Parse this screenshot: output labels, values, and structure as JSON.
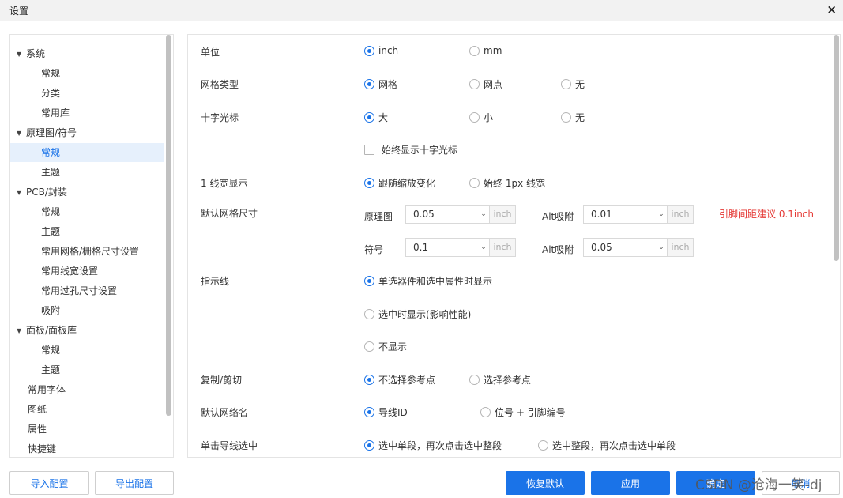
{
  "window": {
    "title": "设置",
    "close": "×"
  },
  "tree": {
    "items": [
      {
        "label": "系统",
        "caret": "▼"
      },
      {
        "label": "常规"
      },
      {
        "label": "分类"
      },
      {
        "label": "常用库"
      },
      {
        "label": "原理图/符号",
        "caret": "▼"
      },
      {
        "label": "常规"
      },
      {
        "label": "主题"
      },
      {
        "label": "PCB/封装",
        "caret": "▼"
      },
      {
        "label": "常规"
      },
      {
        "label": "主题"
      },
      {
        "label": "常用网格/栅格尺寸设置"
      },
      {
        "label": "常用线宽设置"
      },
      {
        "label": "常用过孔尺寸设置"
      },
      {
        "label": "吸附"
      },
      {
        "label": "面板/面板库",
        "caret": "▼"
      },
      {
        "label": "常规"
      },
      {
        "label": "主题"
      },
      {
        "label": "常用字体"
      },
      {
        "label": "图纸"
      },
      {
        "label": "属性"
      },
      {
        "label": "快捷键"
      }
    ],
    "selected_index": 5
  },
  "settings": {
    "unit": {
      "label": "单位",
      "options": [
        "inch",
        "mm"
      ]
    },
    "grid_type": {
      "label": "网格类型",
      "options": [
        "网格",
        "网点",
        "无"
      ]
    },
    "crosshair": {
      "label": "十字光标",
      "options": [
        "大",
        "小",
        "无"
      ],
      "checkbox": "始终显示十字光标"
    },
    "line_width": {
      "label": "1 线宽显示",
      "options": [
        "跟随缩放变化",
        "始终 1px 线宽"
      ]
    },
    "default_grid": {
      "label": "默认网格尺寸",
      "schematic_label": "原理图",
      "schematic_value": "0.05",
      "schematic_unit": "inch",
      "alt_label": "Alt吸附",
      "alt_value": "0.01",
      "alt_unit": "inch",
      "symbol_label": "符号",
      "symbol_value": "0.1",
      "symbol_unit": "inch",
      "symbol_alt_label": "Alt吸附",
      "symbol_alt_value": "0.05",
      "symbol_alt_unit": "inch",
      "hint": "引脚间距建议 0.1inch"
    },
    "indicator": {
      "label": "指示线",
      "options": [
        "单选器件和选中属性时显示",
        "选中时显示(影响性能)",
        "不显示"
      ]
    },
    "copy_cut": {
      "label": "复制/剪切",
      "options": [
        "不选择参考点",
        "选择参考点"
      ]
    },
    "net_name": {
      "label": "默认网络名",
      "options": [
        "导线ID",
        "位号 + 引脚编号"
      ]
    },
    "wire_click": {
      "label": "单击导线选中",
      "options": [
        "选中单段，再次点击选中整段",
        "选中整段，再次点击选中单段"
      ]
    }
  },
  "buttons": {
    "import": "导入配置",
    "export": "导出配置",
    "restore": "恢复默认",
    "apply": "应用",
    "ok": "确定",
    "cancel": "取消"
  },
  "watermark": "CSDN @沧海一笑-dj",
  "colors": {
    "accent": "#1a73e8",
    "hint": "#e53935",
    "selected_bg": "#e6f0fc"
  }
}
